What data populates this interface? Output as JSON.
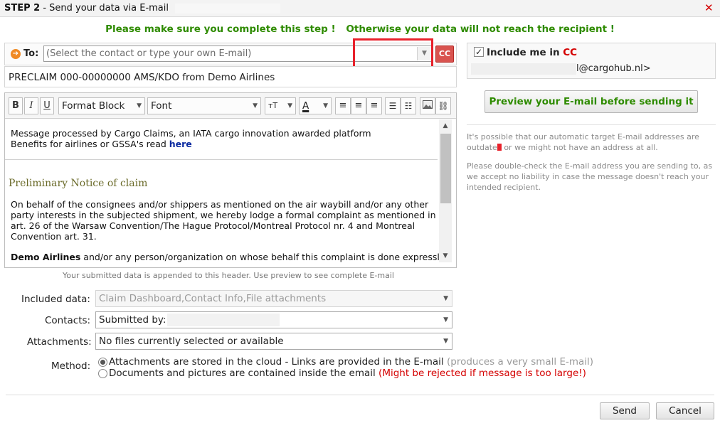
{
  "dialog": {
    "step": "STEP 2",
    "title_rest": " - Send your data via E-mail",
    "close_icon": "close-icon"
  },
  "warning": {
    "part1": "Please make sure you complete this step !",
    "part2": "Otherwise your data will not reach the recipient !"
  },
  "to": {
    "label": "To:",
    "placeholder": "(Select the contact or type your own E-mail)",
    "cc_button": "CC"
  },
  "subject": "PRECLAIM 000-00000000 AMS/KDO from Demo Airlines",
  "toolbar": {
    "bold": "B",
    "italic": "I",
    "underline": "U",
    "format_block": "Format Block",
    "font": "Font"
  },
  "editor": {
    "line1": "Message processed by Cargo Claims, an IATA cargo innovation awarded platform",
    "line2_prefix": "Benefits for airlines or GSSA's read ",
    "line2_link": "here",
    "heading": "Preliminary Notice of claim",
    "para1_l1": "On behalf of the consignees and/or shippers as mentioned on the air waybill and/or any other",
    "para1_l2": "party interests in the subjected shipment, we hereby lodge a formal complaint as mentioned in",
    "para1_l3": "art. 26 of the Warsaw Convention/The Hague Protocol/Montreal Protocol nr. 4 and Montreal",
    "para1_l4": "Convention art. 31.",
    "para2_bold": "Demo Airlines",
    "para2_rest": " and/or any person/organization on whose behalf this complaint is done expressly"
  },
  "append_note": "Your submitted data is appended to this header. Use preview to see complete E-mail",
  "cc_panel": {
    "label_prefix": "Include me in ",
    "label_cc": "CC",
    "checked": true,
    "email_suffix": "l@cargohub.nl>"
  },
  "preview_button": "Preview your E-mail before sending it",
  "info": {
    "p1_a": "It's possible that our automatic target E-mail addresses are",
    "p1_b_prefix": "outdate",
    "p1_b_suffix": " or we might not have an address at all.",
    "p2_l1": "Please double-check the E-mail address you are sending to, as",
    "p2_l2": "we accept no liability in case the message doesn't reach your",
    "p2_l3": "intended recipient."
  },
  "form": {
    "included_label": "Included data:",
    "included_value": "Claim Dashboard,Contact Info,File attachments",
    "contacts_label": "Contacts:",
    "contacts_value": "Submitted by:",
    "attachments_label": "Attachments:",
    "attachments_value": "No files currently selected or available",
    "method_label": "Method:",
    "method_option1": "Attachments are stored in the cloud - Links are provided in the E-mail",
    "method_option1_note": " (produces a very small E-mail)",
    "method_option2": "Documents and pictures are contained inside the email",
    "method_option2_note": " (Might be rejected if message is too large!)",
    "method_selected": 1
  },
  "buttons": {
    "send": "Send",
    "cancel": "Cancel"
  },
  "colors": {
    "accent_green": "#2e8b00",
    "red": "#d40000",
    "highlight": "#e8212b",
    "cc_button": "#d9534f"
  }
}
